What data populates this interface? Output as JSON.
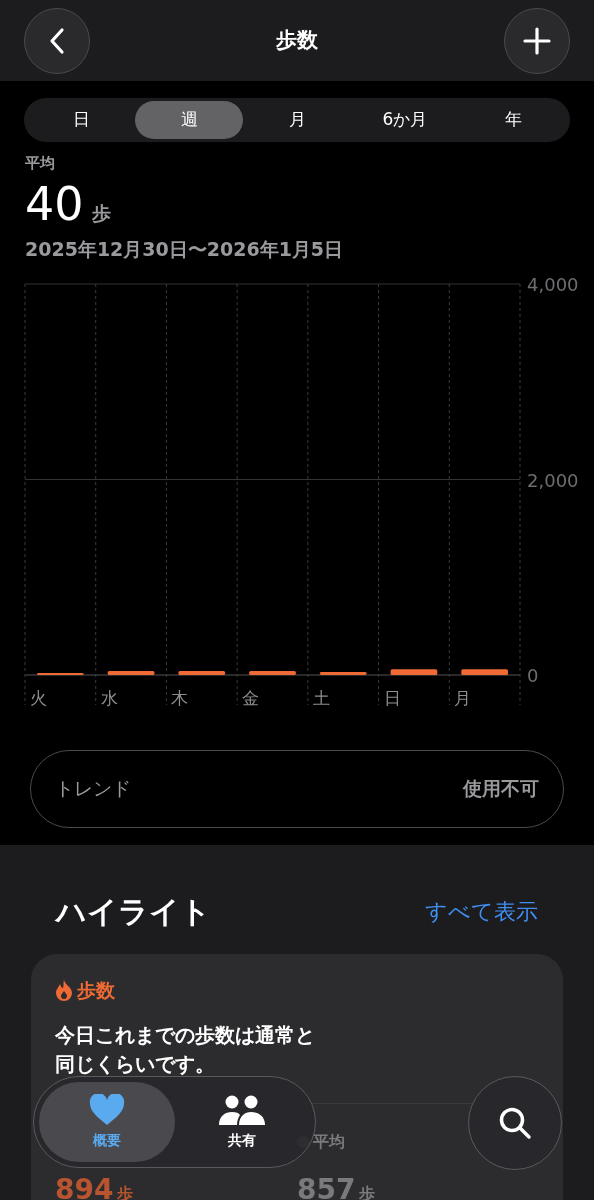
{
  "header": {
    "title": "歩数"
  },
  "periods": [
    {
      "label": "日",
      "selected": false
    },
    {
      "label": "週",
      "selected": true
    },
    {
      "label": "月",
      "selected": false
    },
    {
      "label": "6か月",
      "selected": false
    },
    {
      "label": "年",
      "selected": false
    }
  ],
  "summary": {
    "label": "平均",
    "value": "40",
    "unit": "歩",
    "range": "2025年12月30日〜2026年1月5日"
  },
  "chart_data": {
    "type": "bar",
    "categories": [
      "火",
      "水",
      "木",
      "金",
      "土",
      "日",
      "月"
    ],
    "series": [
      {
        "color": "#f06a35",
        "values": [
          20,
          40,
          40,
          40,
          30,
          60,
          60
        ]
      }
    ],
    "ylim": [
      0,
      4000
    ],
    "yticks": [
      {
        "value": 0,
        "label": "0"
      },
      {
        "value": 2000,
        "label": "2,000"
      },
      {
        "value": 4000,
        "label": "4,000"
      }
    ]
  },
  "trend": {
    "label": "トレンド",
    "value": "使用不可"
  },
  "highlights": {
    "title": "ハイライト",
    "link": "すべて表示",
    "card": {
      "category": "歩数",
      "text": "今日これまでの歩数は通常と同じくらいです。",
      "stats": [
        {
          "value": "894",
          "unit": "歩"
        },
        {
          "label": "平均",
          "value": "857",
          "unit": "歩"
        }
      ]
    }
  },
  "tab_bar": {
    "tabs": [
      {
        "label": "概要",
        "kind": "heart",
        "selected": true
      },
      {
        "label": "共有",
        "kind": "people",
        "selected": false
      }
    ]
  }
}
